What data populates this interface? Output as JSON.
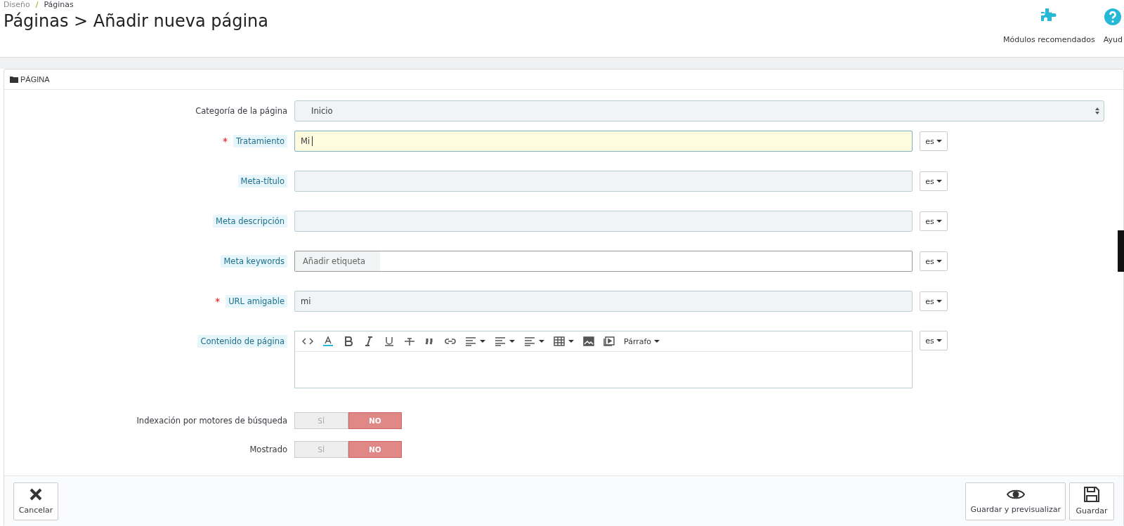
{
  "breadcrumb": {
    "separator": "/",
    "items": [
      "Diseño",
      "Páginas"
    ]
  },
  "required_marker": "*",
  "title": "Páginas > Añadir nueva página",
  "toolbar": [
    {
      "kind": "modules",
      "label": "Módulos recomendados"
    },
    {
      "kind": "help",
      "label": "Ayud"
    }
  ],
  "panel": {
    "title": "PÁGINA"
  },
  "fields": [
    {
      "kind": "select",
      "label": "Categoría de la página",
      "required": false,
      "hint": false,
      "value": "Inicio"
    },
    {
      "kind": "text",
      "label": "Tratamiento",
      "required": true,
      "hint": true,
      "focused": true,
      "value": "Mi",
      "lang": "es"
    },
    {
      "kind": "text",
      "label": "Meta-título",
      "required": false,
      "hint": true,
      "focused": false,
      "lang": "es"
    },
    {
      "kind": "text",
      "label": "Meta descripción",
      "required": false,
      "hint": true,
      "focused": false,
      "lang": "es"
    },
    {
      "kind": "tags",
      "label": "Meta keywords",
      "required": false,
      "hint": true,
      "placeholder": "Añadir etiqueta",
      "lang": "es"
    },
    {
      "kind": "text",
      "label": "URL amigable",
      "required": true,
      "hint": true,
      "focused": false,
      "value": "mi",
      "lang": "es"
    },
    {
      "kind": "editor",
      "label": "Contenido de página",
      "required": false,
      "hint": true,
      "format": "Párrafo",
      "lang": "es"
    }
  ],
  "switches": [
    {
      "label": "Indexación por motores de búsqueda",
      "options": [
        {
          "label": "SÍ",
          "selected": false
        },
        {
          "label": "NO",
          "selected": true
        }
      ]
    },
    {
      "label": "Mostrado",
      "options": [
        {
          "label": "SÍ",
          "selected": false
        },
        {
          "label": "NO",
          "selected": true
        }
      ]
    }
  ],
  "footer": {
    "left": [
      {
        "kind": "cancel",
        "label": "Cancelar"
      }
    ],
    "right": [
      {
        "kind": "preview",
        "label": "Guardar y previsualizar"
      },
      {
        "kind": "save",
        "label": "Guardar"
      }
    ]
  }
}
